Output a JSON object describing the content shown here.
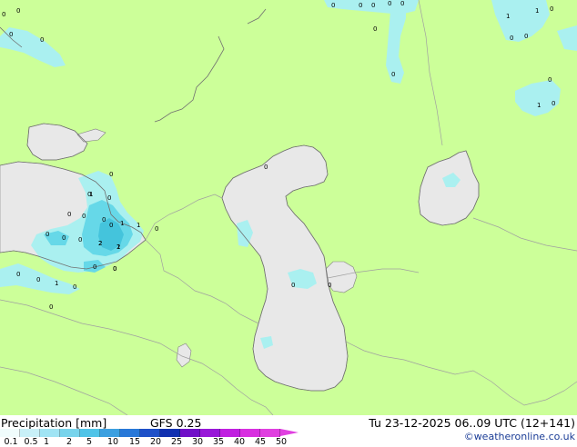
{
  "map": {
    "colors": {
      "land": "#ccff99",
      "water": "#e8e8e8",
      "border": "#a0a0a0",
      "coast": "#808080",
      "precip_light": "#aaf0f0",
      "precip_medium": "#66d8e8",
      "precip_strong": "#44c4dc"
    },
    "labels": [
      "0",
      "0",
      "0",
      "0",
      "0",
      "0",
      "0",
      "1",
      "1",
      "0",
      "0",
      "0",
      "0",
      "0",
      "0",
      "0",
      "1",
      "0",
      "0",
      "0",
      "0",
      "0",
      "0",
      "0",
      "0",
      "0",
      "1",
      "0",
      "0",
      "1",
      "2",
      "1",
      "0",
      "0",
      "0",
      "1",
      "2",
      "2",
      "0",
      "0",
      "0",
      "0",
      "1",
      "0",
      "0",
      "0",
      "0",
      "0"
    ]
  },
  "footer": {
    "legend_title": "Precipitation [mm]",
    "model": "GFS 0.25",
    "valid_time": "Tu 23-12-2025 06..09 UTC (12+141)",
    "credit": "©weatheronline.co.uk",
    "scale_ticks": [
      "0.1",
      "0.5",
      "1",
      "2",
      "5",
      "10",
      "15",
      "20",
      "25",
      "30",
      "35",
      "40",
      "45",
      "50"
    ],
    "scale_colors": [
      "#f0fcfc",
      "#c8f0f8",
      "#a0e4f4",
      "#78d4ec",
      "#50c4e8",
      "#3ca0e0",
      "#2878d8",
      "#1e50c8",
      "#1030b0",
      "#7010c8",
      "#9818d8",
      "#c020e0",
      "#d830e0",
      "#e040e0"
    ]
  }
}
